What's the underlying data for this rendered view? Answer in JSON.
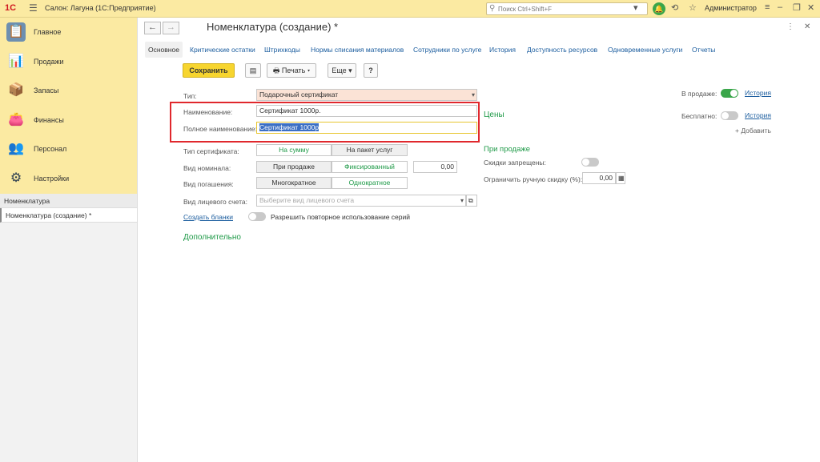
{
  "topbar": {
    "logo": "1С",
    "title": "Салон: Лагуна  (1С:Предприятие)",
    "search_placeholder": "Поиск Ctrl+Shift+F",
    "user": "Администратор"
  },
  "sidebar": {
    "sections": [
      {
        "label": "Главное",
        "icon": "clipboard-icon"
      },
      {
        "label": "Продажи",
        "icon": "sales-chart-icon"
      },
      {
        "label": "Запасы",
        "icon": "boxes-icon"
      },
      {
        "label": "Финансы",
        "icon": "wallet-icon"
      },
      {
        "label": "Персонал",
        "icon": "people-icon"
      },
      {
        "label": "Настройки",
        "icon": "gear-icon"
      }
    ],
    "open_windows": [
      "Номенклатура",
      "Номенклатура (создание) *"
    ]
  },
  "form": {
    "title": "Номенклатура (создание) *",
    "tabs": [
      "Основное",
      "Критические остатки",
      "Штрихкоды",
      "Нормы списания материалов",
      "Сотрудники по услуге",
      "История",
      "Доступность ресурсов",
      "Одновременные услуги",
      "Отчеты"
    ],
    "toolbar": {
      "save": "Сохранить",
      "print": "Печать",
      "more": "Еще",
      "help": "?"
    },
    "fields": {
      "type_label": "Тип:",
      "type_value": "Подарочный сертификат",
      "name_label": "Наименование:",
      "name_value": "Сертификат 1000р.",
      "fullname_label": "Полное наименование:",
      "fullname_value": "Сертификат 1000р",
      "cert_type_label": "Тип сертификата:",
      "cert_type_opt1": "На сумму",
      "cert_type_opt2": "На пакет услуг",
      "nominal_label": "Вид номинала:",
      "nominal_opt1": "При продаже",
      "nominal_opt2": "Фиксированный",
      "nominal_value": "0,00",
      "repay_label": "Вид погашения:",
      "repay_opt1": "Многократное",
      "repay_opt2": "Однократное",
      "account_label": "Вид лицевого счета:",
      "account_placeholder": "Выберите вид лицевого счета",
      "create_blanks": "Создать бланки",
      "allow_reuse": "Разрешить повторное использование серий",
      "additional": "Дополнительно"
    },
    "right": {
      "on_sale_label": "В продаже:",
      "history": "История",
      "free_label": "Бесплатно:",
      "add": "+ Добавить",
      "prices": "Цены",
      "on_sale_heading": "При продаже",
      "discounts_forbidden": "Скидки запрещены:",
      "limit_manual": "Ограничить ручную скидку (%):",
      "limit_value": "0,00"
    }
  }
}
